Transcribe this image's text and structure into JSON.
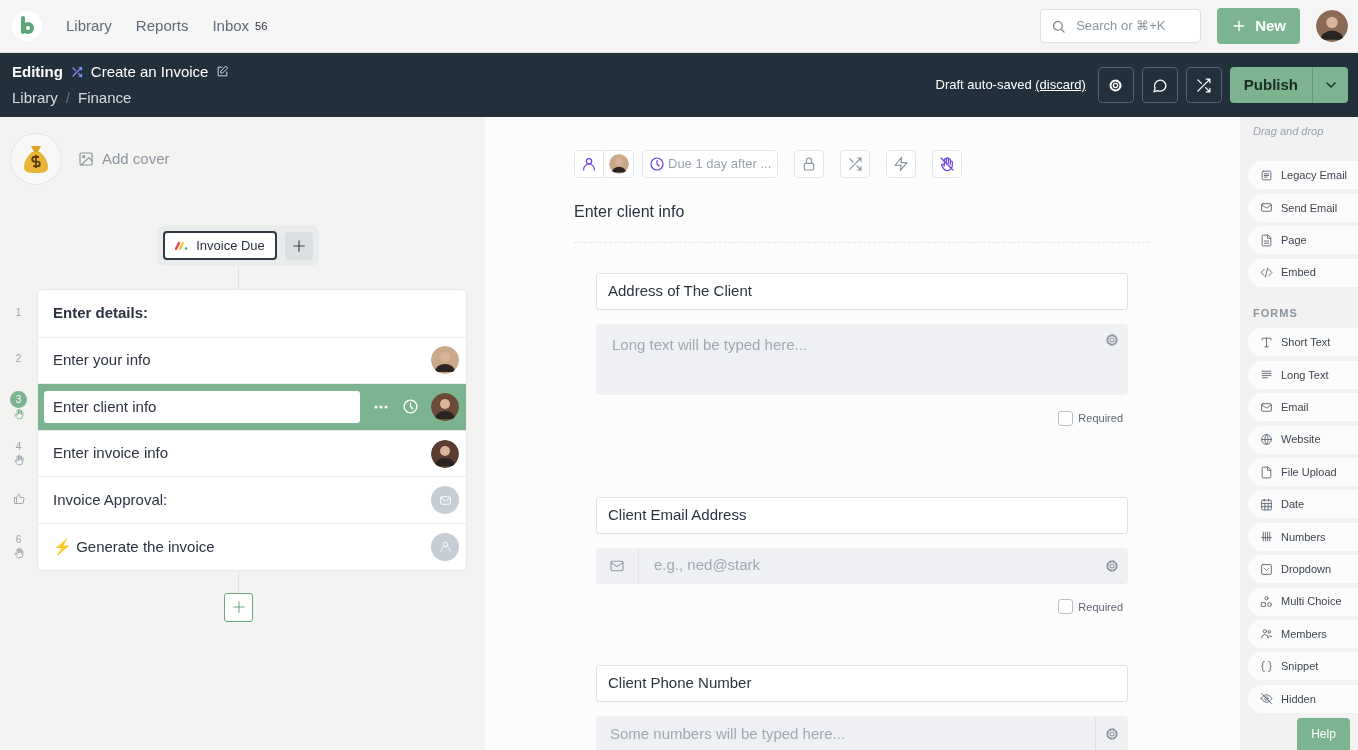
{
  "nav": {
    "links": [
      {
        "label": "Library"
      },
      {
        "label": "Reports"
      },
      {
        "label": "Inbox",
        "badge": "56"
      }
    ],
    "search": {
      "placeholder": "Search or ⌘+K"
    },
    "new_button": "New"
  },
  "editor_bar": {
    "mode": "Editing",
    "title": "Create an Invoice",
    "breadcrumb": [
      "Library",
      "Finance"
    ],
    "breadcrumb_separator": "/",
    "draft_status": "Draft auto-saved",
    "discard_link": "(discard)",
    "publish_button": "Publish"
  },
  "cover": {
    "add_cover": "Add cover"
  },
  "trigger": {
    "label": "Invoice Due"
  },
  "steps": [
    {
      "number": "1",
      "kind": "heading",
      "title": "Enter details:",
      "selected": false,
      "stop": false
    },
    {
      "number": "2",
      "kind": "task",
      "title": "Enter your info",
      "selected": false,
      "stop": false,
      "assignee": {
        "kind": "avatar"
      }
    },
    {
      "number": "3",
      "kind": "task",
      "title": "Enter client info",
      "selected": true,
      "stop": true,
      "assignee": {
        "kind": "avatar"
      }
    },
    {
      "number": "4",
      "kind": "task",
      "title": "Enter invoice info",
      "selected": false,
      "stop": true,
      "assignee": {
        "kind": "avatar"
      }
    },
    {
      "kind": "approval",
      "title": "Invoice Approval:",
      "selected": false,
      "stop": false,
      "assignee": {
        "kind": "email"
      }
    },
    {
      "number": "6",
      "kind": "task",
      "title": "⚡ Generate the invoice",
      "selected": false,
      "stop": true,
      "assignee": {
        "kind": "person"
      }
    }
  ],
  "task": {
    "due": "Due 1 day after ...",
    "title": "Enter client info",
    "fields": [
      {
        "kind": "long_text",
        "label": "Address of The Client",
        "placeholder": "Long text will be typed here...",
        "required": false,
        "required_label": "Required"
      },
      {
        "kind": "email",
        "label": "Client Email Address",
        "placeholder": "e.g., ned@stark",
        "required": false,
        "required_label": "Required"
      },
      {
        "kind": "number",
        "label": "Client Phone Number",
        "placeholder": "Some numbers will be typed here..."
      }
    ]
  },
  "palette": {
    "hint": "Drag and drop",
    "content_items": [
      {
        "label": "Legacy Email",
        "kind": "legacy-email"
      },
      {
        "label": "Send Email",
        "kind": "mail"
      },
      {
        "label": "Page",
        "kind": "page"
      },
      {
        "label": "Embed",
        "kind": "code"
      }
    ],
    "forms_heading": "FORMS",
    "form_items": [
      {
        "label": "Short Text",
        "kind": "text"
      },
      {
        "label": "Long Text",
        "kind": "lines"
      },
      {
        "label": "Email",
        "kind": "mail"
      },
      {
        "label": "Website",
        "kind": "globe"
      },
      {
        "label": "File Upload",
        "kind": "file"
      },
      {
        "label": "Date",
        "kind": "calendar"
      },
      {
        "label": "Numbers",
        "kind": "tally"
      },
      {
        "label": "Dropdown",
        "kind": "dropdown"
      },
      {
        "label": "Multi Choice",
        "kind": "shapes"
      },
      {
        "label": "Members",
        "kind": "members"
      },
      {
        "label": "Snippet",
        "kind": "braces"
      },
      {
        "label": "Hidden",
        "kind": "eye-off"
      }
    ]
  },
  "help_button": "Help"
}
